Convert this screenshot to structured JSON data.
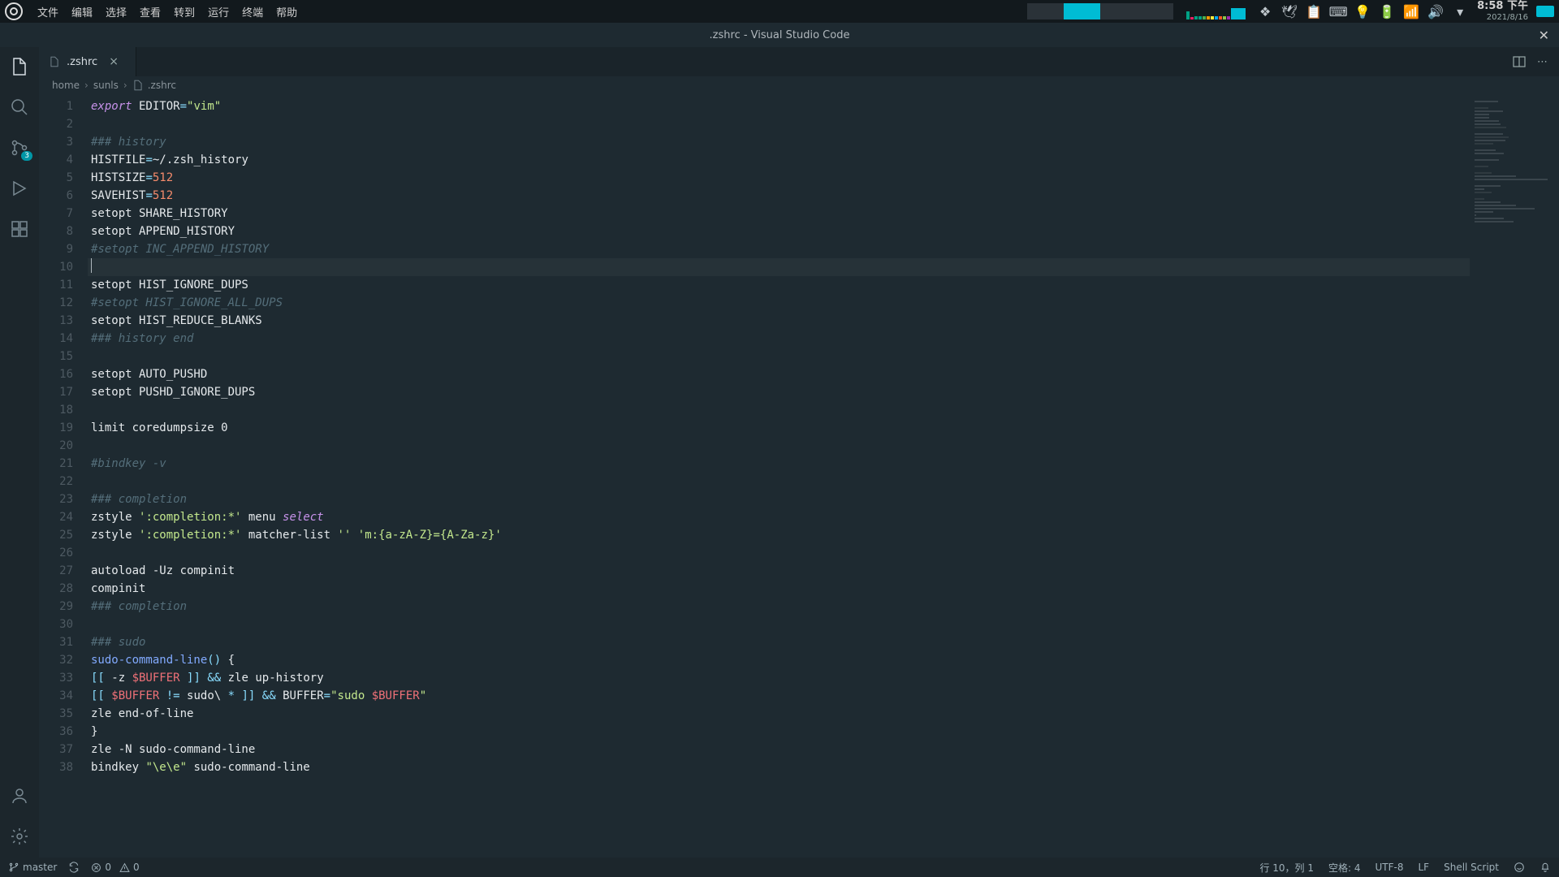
{
  "os": {
    "menu": [
      "文件",
      "编辑",
      "选择",
      "查看",
      "转到",
      "运行",
      "终端",
      "帮助"
    ],
    "clock_time": "8:58 下午",
    "clock_date": "2021/8/16"
  },
  "window": {
    "title": ".zshrc - Visual Studio Code"
  },
  "activity": {
    "scm_badge": "3"
  },
  "tab": {
    "filename": ".zshrc"
  },
  "breadcrumbs": {
    "parts": [
      "home",
      "sunls",
      ".zshrc"
    ]
  },
  "editor": {
    "current_line": 10,
    "lines": [
      {
        "n": 1,
        "tokens": [
          [
            "kw",
            "export"
          ],
          [
            "",
            ""
          ],
          [
            "id",
            " EDITOR"
          ],
          [
            "op",
            "="
          ],
          [
            "str",
            "\"vim\""
          ]
        ]
      },
      {
        "n": 2,
        "tokens": []
      },
      {
        "n": 3,
        "tokens": [
          [
            "cmt",
            "### history"
          ]
        ]
      },
      {
        "n": 4,
        "tokens": [
          [
            "id",
            "HISTFILE"
          ],
          [
            "op",
            "="
          ],
          [
            "id",
            "~/.zsh_history"
          ]
        ]
      },
      {
        "n": 5,
        "tokens": [
          [
            "id",
            "HISTSIZE"
          ],
          [
            "op",
            "="
          ],
          [
            "num",
            "512"
          ]
        ]
      },
      {
        "n": 6,
        "tokens": [
          [
            "id",
            "SAVEHIST"
          ],
          [
            "op",
            "="
          ],
          [
            "num",
            "512"
          ]
        ]
      },
      {
        "n": 7,
        "tokens": [
          [
            "id",
            "setopt SHARE_HISTORY"
          ]
        ]
      },
      {
        "n": 8,
        "tokens": [
          [
            "id",
            "setopt APPEND_HISTORY"
          ]
        ]
      },
      {
        "n": 9,
        "tokens": [
          [
            "cmt",
            "#setopt INC_APPEND_HISTORY"
          ]
        ]
      },
      {
        "n": 10,
        "tokens": []
      },
      {
        "n": 11,
        "tokens": [
          [
            "id",
            "setopt HIST_IGNORE_DUPS"
          ]
        ]
      },
      {
        "n": 12,
        "tokens": [
          [
            "cmt",
            "#setopt HIST_IGNORE_ALL_DUPS"
          ]
        ]
      },
      {
        "n": 13,
        "tokens": [
          [
            "id",
            "setopt HIST_REDUCE_BLANKS"
          ]
        ]
      },
      {
        "n": 14,
        "tokens": [
          [
            "cmt",
            "### history end"
          ]
        ]
      },
      {
        "n": 15,
        "tokens": []
      },
      {
        "n": 16,
        "tokens": [
          [
            "id",
            "setopt AUTO_PUSHD"
          ]
        ]
      },
      {
        "n": 17,
        "tokens": [
          [
            "id",
            "setopt PUSHD_IGNORE_DUPS"
          ]
        ]
      },
      {
        "n": 18,
        "tokens": []
      },
      {
        "n": 19,
        "tokens": [
          [
            "id",
            "limit coredumpsize 0"
          ]
        ]
      },
      {
        "n": 20,
        "tokens": []
      },
      {
        "n": 21,
        "tokens": [
          [
            "cmt",
            "#bindkey -v"
          ]
        ]
      },
      {
        "n": 22,
        "tokens": []
      },
      {
        "n": 23,
        "tokens": [
          [
            "cmt",
            "### completion"
          ]
        ]
      },
      {
        "n": 24,
        "tokens": [
          [
            "id",
            "zstyle "
          ],
          [
            "str",
            "':completion:*'"
          ],
          [
            "id",
            " menu "
          ],
          [
            "kw",
            "select"
          ]
        ]
      },
      {
        "n": 25,
        "tokens": [
          [
            "id",
            "zstyle "
          ],
          [
            "str",
            "':completion:*'"
          ],
          [
            "id",
            " matcher-list "
          ],
          [
            "str",
            "''"
          ],
          [
            "id",
            " "
          ],
          [
            "str",
            "'m:{a-zA-Z}={A-Za-z}'"
          ]
        ]
      },
      {
        "n": 26,
        "tokens": []
      },
      {
        "n": 27,
        "tokens": [
          [
            "id",
            "autoload -Uz compinit"
          ]
        ]
      },
      {
        "n": 28,
        "tokens": [
          [
            "id",
            "compinit"
          ]
        ]
      },
      {
        "n": 29,
        "tokens": [
          [
            "cmt",
            "### completion"
          ]
        ]
      },
      {
        "n": 30,
        "tokens": []
      },
      {
        "n": 31,
        "tokens": [
          [
            "cmt",
            "### sudo"
          ]
        ]
      },
      {
        "n": 32,
        "tokens": [
          [
            "fn",
            "sudo-command-line"
          ],
          [
            "op",
            "()"
          ],
          [
            "id",
            " {"
          ]
        ]
      },
      {
        "n": 33,
        "tokens": [
          [
            "op",
            "[["
          ],
          [
            "id",
            " -z "
          ],
          [
            "var",
            "$BUFFER"
          ],
          [
            "id",
            " "
          ],
          [
            "op",
            "]]"
          ],
          [
            "id",
            " "
          ],
          [
            "op",
            "&&"
          ],
          [
            "id",
            " zle up-history"
          ]
        ]
      },
      {
        "n": 34,
        "tokens": [
          [
            "op",
            "[["
          ],
          [
            "id",
            " "
          ],
          [
            "var",
            "$BUFFER"
          ],
          [
            "id",
            " "
          ],
          [
            "op",
            "!="
          ],
          [
            "id",
            " sudo\\ "
          ],
          [
            "op",
            "*"
          ],
          [
            "id",
            " "
          ],
          [
            "op",
            "]]"
          ],
          [
            "id",
            " "
          ],
          [
            "op",
            "&&"
          ],
          [
            "id",
            " BUFFER"
          ],
          [
            "op",
            "="
          ],
          [
            "str",
            "\"sudo "
          ],
          [
            "var",
            "$BUFFER"
          ],
          [
            "str",
            "\""
          ]
        ]
      },
      {
        "n": 35,
        "tokens": [
          [
            "id",
            "zle end-of-line"
          ]
        ]
      },
      {
        "n": 36,
        "tokens": [
          [
            "id",
            "}"
          ]
        ]
      },
      {
        "n": 37,
        "tokens": [
          [
            "id",
            "zle -N sudo-command-line"
          ]
        ]
      },
      {
        "n": 38,
        "tokens": [
          [
            "id",
            "bindkey "
          ],
          [
            "str",
            "\"\\e\\e\""
          ],
          [
            "id",
            " sudo-command-line"
          ]
        ]
      }
    ]
  },
  "status": {
    "branch": "master",
    "errors": "0",
    "warnings": "0",
    "line_col": "行 10，列 1",
    "spaces": "空格: 4",
    "encoding": "UTF-8",
    "eol": "LF",
    "lang": "Shell Script"
  }
}
